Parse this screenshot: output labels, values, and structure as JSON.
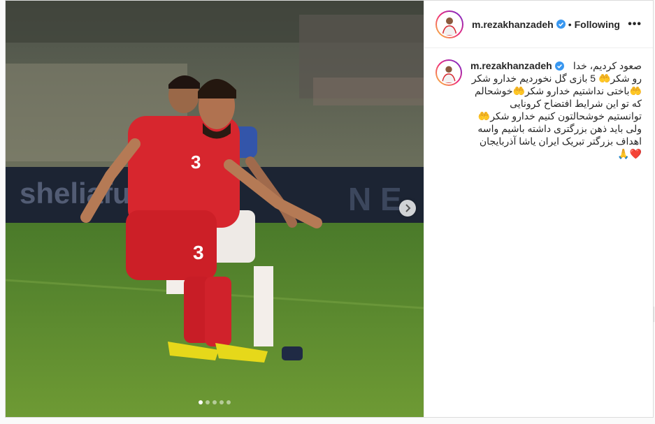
{
  "post": {
    "username": "m.rezakhanzadeh",
    "separator": "•",
    "follow_label": "Following",
    "more_label": "•••",
    "carousel": {
      "dot_count": 5,
      "active_index": 0
    }
  },
  "caption": {
    "username": "m.rezakhanzadeh",
    "lines": [
      "صعود کردیم، خدا",
      "رو شکر🤲 5 بازی گل نخوردیم خدارو شکر",
      "🤲باختی نداشتیم خدارو شکر🤲خوشحالم",
      "که تو این شرایط افتضاح کرونایی",
      "توانستیم خوشحالتون کنیم خدارو شکر🤲",
      "ولی باید ذهن بزرگتری داشته باشیم واسه",
      "اهداف بزرگتر تبریک ایران یاشا آذربایجان",
      "❤️🙏"
    ]
  },
  "colors": {
    "verified": "#3897f0",
    "link": "#262626",
    "border": "#dbdbdb",
    "jersey_red": "#d7262e"
  },
  "icons": {
    "verified": "verified-badge-icon",
    "next": "chevron-right-icon",
    "more": "more-options-icon"
  }
}
